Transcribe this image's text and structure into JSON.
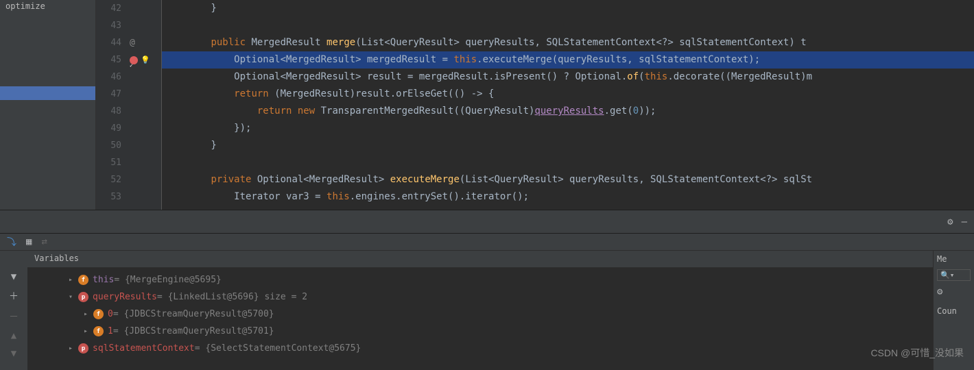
{
  "left_panel": {
    "item": "optimize"
  },
  "code": {
    "lines": [
      {
        "num": "42",
        "text": "        }"
      },
      {
        "num": "43",
        "text": ""
      },
      {
        "num": "44",
        "icon": "override",
        "segments": [
          {
            "t": "        "
          },
          {
            "t": "public",
            "c": "kw"
          },
          {
            "t": " MergedResult "
          },
          {
            "t": "merge",
            "c": "method"
          },
          {
            "t": "(List<QueryResult> queryResults, SQLStatementContext<?> sqlStatementContext) t"
          }
        ]
      },
      {
        "num": "45",
        "hl": true,
        "bp": true,
        "bulb": true,
        "segments": [
          {
            "t": "            Optional<MergedResult> mergedResult = "
          },
          {
            "t": "this",
            "c": "kw"
          },
          {
            "t": ".executeMerge(queryResults, sqlStatementContext);"
          }
        ]
      },
      {
        "num": "46",
        "segments": [
          {
            "t": "            Optional<MergedResult> result = mergedResult.isPresent() ? Optional."
          },
          {
            "t": "of",
            "c": "method"
          },
          {
            "t": "("
          },
          {
            "t": "this",
            "c": "kw"
          },
          {
            "t": ".decorate((MergedResult)m"
          }
        ]
      },
      {
        "num": "47",
        "segments": [
          {
            "t": "            "
          },
          {
            "t": "return",
            "c": "kw"
          },
          {
            "t": " (MergedResult)result.orElseGet(() -> {"
          }
        ]
      },
      {
        "num": "48",
        "segments": [
          {
            "t": "                "
          },
          {
            "t": "return new",
            "c": "kw"
          },
          {
            "t": " TransparentMergedResult((QueryResult)"
          },
          {
            "t": "queryResults",
            "c": "underline"
          },
          {
            "t": ".get("
          },
          {
            "t": "0",
            "c": "num"
          },
          {
            "t": "));"
          }
        ]
      },
      {
        "num": "49",
        "text": "            });"
      },
      {
        "num": "50",
        "text": "        }"
      },
      {
        "num": "51",
        "text": ""
      },
      {
        "num": "52",
        "segments": [
          {
            "t": "        "
          },
          {
            "t": "private",
            "c": "kw"
          },
          {
            "t": " Optional<MergedResult> "
          },
          {
            "t": "executeMerge",
            "c": "method"
          },
          {
            "t": "(List<QueryResult> queryResults, SQLStatementContext<?> sqlSt"
          }
        ]
      },
      {
        "num": "53",
        "segments": [
          {
            "t": "            Iterator var3 = "
          },
          {
            "t": "this",
            "c": "kw"
          },
          {
            "t": ".engines.entrySet().iterator();"
          }
        ]
      }
    ]
  },
  "debug": {
    "vars_title": "Variables",
    "right_label": "Me",
    "right_coun": "Coun",
    "tree": [
      {
        "indent": 0,
        "arrow": "▸",
        "badge": "f",
        "name": "this",
        "nclass": "var-this",
        "val": " = {MergeEngine@5695}"
      },
      {
        "indent": 0,
        "arrow": "▾",
        "badge": "p",
        "bclass": "param-badge",
        "name": "queryResults",
        "nclass": "var-name",
        "val": " = {LinkedList@5696}  size = 2"
      },
      {
        "indent": 1,
        "arrow": "▸",
        "badge": "f",
        "name": "0",
        "nclass": "var-name",
        "val": " = {JDBCStreamQueryResult@5700}"
      },
      {
        "indent": 1,
        "arrow": "▸",
        "badge": "f",
        "name": "1",
        "nclass": "var-name",
        "val": " = {JDBCStreamQueryResult@5701}"
      },
      {
        "indent": 0,
        "arrow": "▸",
        "badge": "p",
        "bclass": "param-badge",
        "name": "sqlStatementContext",
        "nclass": "var-name",
        "val": " = {SelectStatementContext@5675}"
      }
    ]
  },
  "watermark": "CSDN @可惜_没如果"
}
